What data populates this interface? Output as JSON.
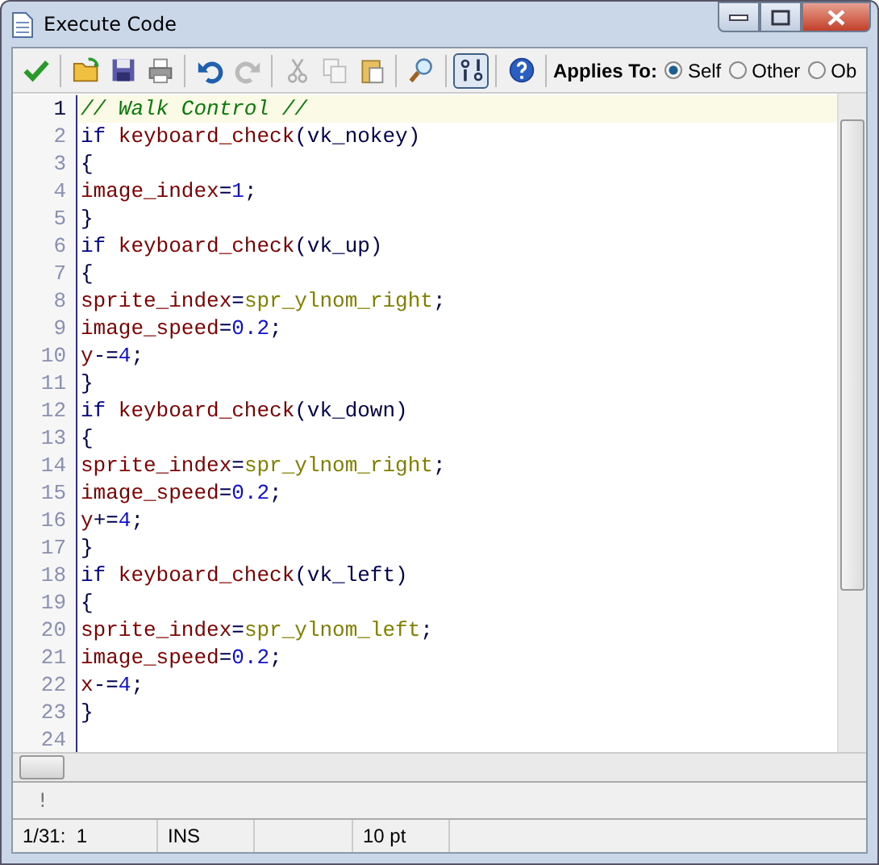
{
  "window": {
    "title": "Execute Code"
  },
  "toolbar": {
    "tools": [
      {
        "kind": "ok"
      },
      {
        "kind": "open"
      },
      {
        "kind": "save"
      },
      {
        "kind": "print"
      },
      {
        "kind": "undo"
      },
      {
        "kind": "redo",
        "disabled": true
      },
      {
        "kind": "cut",
        "disabled": true
      },
      {
        "kind": "copy",
        "disabled": true
      },
      {
        "kind": "paste"
      },
      {
        "kind": "find"
      },
      {
        "kind": "toggle",
        "selected": true
      },
      {
        "kind": "help"
      }
    ],
    "applies_label": "Applies To:",
    "applies": [
      {
        "label": "Self",
        "selected": true
      },
      {
        "label": "Other",
        "selected": false
      },
      {
        "label": "Ob",
        "selected": false
      }
    ]
  },
  "editor": {
    "lines": [
      {
        "number": "1",
        "current": true,
        "tokens": [
          {
            "kind": "comment",
            "text": "// Walk Control //"
          }
        ]
      },
      {
        "number": "2",
        "current": false,
        "tokens": [
          {
            "kind": "keyword",
            "text": "if "
          },
          {
            "kind": "name",
            "text": "keyboard_check"
          },
          {
            "kind": "punct",
            "text": "(vk_nokey)"
          }
        ]
      },
      {
        "number": "3",
        "current": false,
        "tokens": [
          {
            "kind": "punct",
            "text": "{"
          }
        ]
      },
      {
        "number": "4",
        "current": false,
        "tokens": [
          {
            "kind": "name",
            "text": "image_index"
          },
          {
            "kind": "punct",
            "text": "="
          },
          {
            "kind": "number",
            "text": "1"
          },
          {
            "kind": "punct",
            "text": ";"
          }
        ]
      },
      {
        "number": "5",
        "current": false,
        "tokens": [
          {
            "kind": "punct",
            "text": "}"
          }
        ]
      },
      {
        "number": "6",
        "current": false,
        "tokens": [
          {
            "kind": "keyword",
            "text": "if "
          },
          {
            "kind": "name",
            "text": "keyboard_check"
          },
          {
            "kind": "punct",
            "text": "(vk_up)"
          }
        ]
      },
      {
        "number": "7",
        "current": false,
        "tokens": [
          {
            "kind": "punct",
            "text": "{"
          }
        ]
      },
      {
        "number": "8",
        "current": false,
        "tokens": [
          {
            "kind": "name",
            "text": "sprite_index"
          },
          {
            "kind": "punct",
            "text": "="
          },
          {
            "kind": "resource",
            "text": "spr_ylnom_right"
          },
          {
            "kind": "punct",
            "text": ";"
          }
        ]
      },
      {
        "number": "9",
        "current": false,
        "tokens": [
          {
            "kind": "name",
            "text": "image_speed"
          },
          {
            "kind": "punct",
            "text": "="
          },
          {
            "kind": "number",
            "text": "0.2"
          },
          {
            "kind": "punct",
            "text": ";"
          }
        ]
      },
      {
        "number": "10",
        "current": false,
        "tokens": [
          {
            "kind": "name",
            "text": "y"
          },
          {
            "kind": "punct",
            "text": "-="
          },
          {
            "kind": "number",
            "text": "4"
          },
          {
            "kind": "punct",
            "text": ";"
          }
        ]
      },
      {
        "number": "11",
        "current": false,
        "tokens": [
          {
            "kind": "punct",
            "text": "}"
          }
        ]
      },
      {
        "number": "12",
        "current": false,
        "tokens": [
          {
            "kind": "keyword",
            "text": "if "
          },
          {
            "kind": "name",
            "text": "keyboard_check"
          },
          {
            "kind": "punct",
            "text": "(vk_down)"
          }
        ]
      },
      {
        "number": "13",
        "current": false,
        "tokens": [
          {
            "kind": "punct",
            "text": "{"
          }
        ]
      },
      {
        "number": "14",
        "current": false,
        "tokens": [
          {
            "kind": "name",
            "text": "sprite_index"
          },
          {
            "kind": "punct",
            "text": "="
          },
          {
            "kind": "resource",
            "text": "spr_ylnom_right"
          },
          {
            "kind": "punct",
            "text": ";"
          }
        ]
      },
      {
        "number": "15",
        "current": false,
        "tokens": [
          {
            "kind": "name",
            "text": "image_speed"
          },
          {
            "kind": "punct",
            "text": "="
          },
          {
            "kind": "number",
            "text": "0.2"
          },
          {
            "kind": "punct",
            "text": ";"
          }
        ]
      },
      {
        "number": "16",
        "current": false,
        "tokens": [
          {
            "kind": "name",
            "text": "y"
          },
          {
            "kind": "punct",
            "text": "+="
          },
          {
            "kind": "number",
            "text": "4"
          },
          {
            "kind": "punct",
            "text": ";"
          }
        ]
      },
      {
        "number": "17",
        "current": false,
        "tokens": [
          {
            "kind": "punct",
            "text": "}"
          }
        ]
      },
      {
        "number": "18",
        "current": false,
        "tokens": [
          {
            "kind": "keyword",
            "text": "if "
          },
          {
            "kind": "name",
            "text": "keyboard_check"
          },
          {
            "kind": "punct",
            "text": "(vk_left)"
          }
        ]
      },
      {
        "number": "19",
        "current": false,
        "tokens": [
          {
            "kind": "punct",
            "text": "{"
          }
        ]
      },
      {
        "number": "20",
        "current": false,
        "tokens": [
          {
            "kind": "name",
            "text": "sprite_index"
          },
          {
            "kind": "punct",
            "text": "="
          },
          {
            "kind": "resource",
            "text": "spr_ylnom_left"
          },
          {
            "kind": "punct",
            "text": ";"
          }
        ]
      },
      {
        "number": "21",
        "current": false,
        "tokens": [
          {
            "kind": "name",
            "text": "image_speed"
          },
          {
            "kind": "punct",
            "text": "="
          },
          {
            "kind": "number",
            "text": "0.2"
          },
          {
            "kind": "punct",
            "text": ";"
          }
        ]
      },
      {
        "number": "22",
        "current": false,
        "tokens": [
          {
            "kind": "name",
            "text": "x"
          },
          {
            "kind": "punct",
            "text": "-="
          },
          {
            "kind": "number",
            "text": "4"
          },
          {
            "kind": "punct",
            "text": ";"
          }
        ]
      },
      {
        "number": "23",
        "current": false,
        "tokens": [
          {
            "kind": "punct",
            "text": "}"
          }
        ]
      },
      {
        "number": "24",
        "current": false
      }
    ]
  },
  "message": "!",
  "status_bar": [
    "1/31:  1",
    "INS",
    "10 pt"
  ]
}
